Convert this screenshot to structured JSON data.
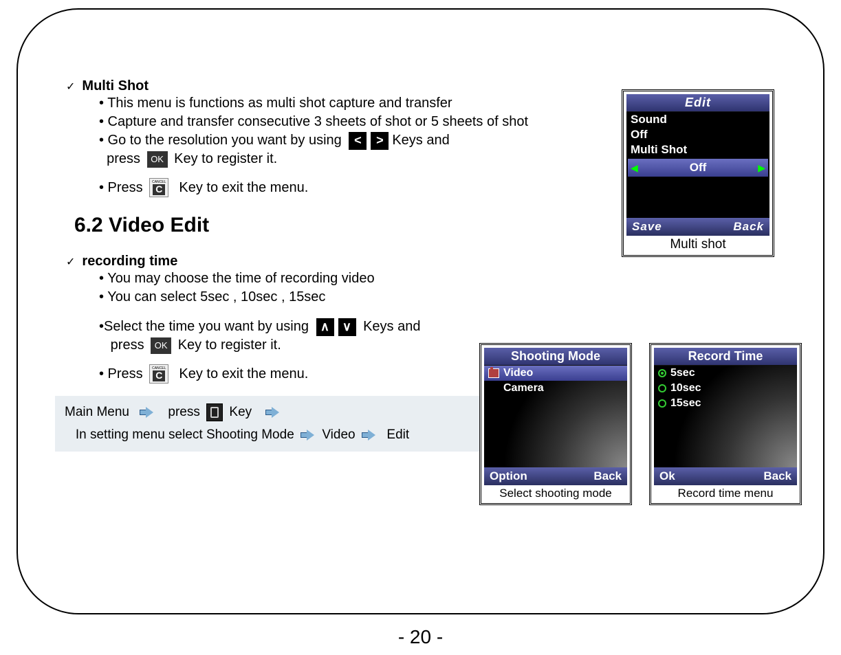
{
  "section1": {
    "title": "Multi Shot",
    "b1": "• This menu is functions as multi shot capture and transfer",
    "b2": "• Capture and transfer consecutive 3 sheets of shot or 5 sheets of shot",
    "b3_a": "• Go to the resolution you want by using ",
    "b3_b": "Keys and",
    "b3_c": "  press ",
    "b3_d": " Key to register it.",
    "b4_a": "• Press ",
    "b4_b": "  Key to exit the menu."
  },
  "heading": "6.2 Video Edit",
  "section2": {
    "title": "recording time",
    "b1": "• You may choose the time of recording video",
    "b2": "• You can select 5sec , 10sec , 15sec",
    "b3_a": "•Select the time you want by using ",
    "b3_b": " Keys and",
    "b3_c": "   press ",
    "b3_d": " Key to register it.",
    "b4_a": "• Press ",
    "b4_b": "  Key to exit the menu."
  },
  "breadcrumb": {
    "a": "Main Menu  ",
    "b": "   press ",
    "c": " Key   ",
    "d": "   In setting menu select Shooting Mode ",
    "e": " Video ",
    "f": "  Edit"
  },
  "phone1": {
    "title": "Edit",
    "l1": "Sound",
    "l2": "Off",
    "l3": "Multi Shot",
    "sel": "Off",
    "soft_l": "Save",
    "soft_r": "Back",
    "caption": "Multi shot"
  },
  "phone2": {
    "title": "Shooting Mode",
    "opt1": "Video",
    "opt2": "Camera",
    "soft_l": "Option",
    "soft_r": "Back",
    "caption": "Select shooting mode"
  },
  "phone3": {
    "title": "Record Time",
    "opt1": "5sec",
    "opt2": "10sec",
    "opt3": "15sec",
    "soft_l": "Ok",
    "soft_r": "Back",
    "caption": "Record time menu"
  },
  "page_number": "- 20 -"
}
